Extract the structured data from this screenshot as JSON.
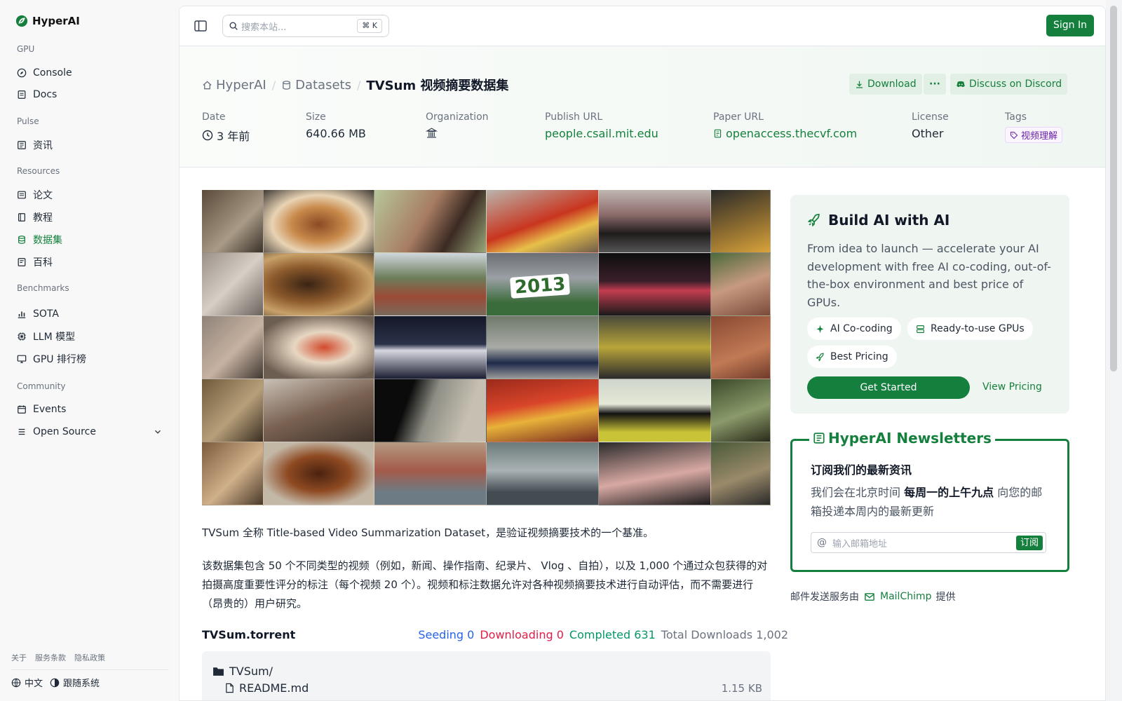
{
  "brand": {
    "name": "HyperAI"
  },
  "sidebar": {
    "sections": [
      {
        "label": "GPU",
        "items": [
          {
            "label": "Console",
            "icon": "compass-icon"
          },
          {
            "label": "Docs",
            "icon": "doc-icon"
          }
        ]
      },
      {
        "label": "Pulse",
        "items": [
          {
            "label": "资讯",
            "icon": "news-icon"
          }
        ]
      },
      {
        "label": "Resources",
        "items": [
          {
            "label": "论文",
            "icon": "paper-icon"
          },
          {
            "label": "教程",
            "icon": "book-icon"
          },
          {
            "label": "数据集",
            "icon": "database-icon",
            "active": true
          },
          {
            "label": "百科",
            "icon": "wiki-icon"
          }
        ]
      },
      {
        "label": "Benchmarks",
        "items": [
          {
            "label": "SOTA",
            "icon": "chart-icon"
          },
          {
            "label": "LLM 模型",
            "icon": "chip-icon"
          },
          {
            "label": "GPU 排行榜",
            "icon": "monitor-icon"
          }
        ]
      },
      {
        "label": "Community",
        "items": [
          {
            "label": "Events",
            "icon": "calendar-icon"
          },
          {
            "label": "Open Source",
            "icon": "list-icon"
          }
        ]
      }
    ],
    "footer": {
      "about": "关于",
      "terms": "服务条款",
      "privacy": "隐私政策",
      "language": "中文",
      "theme": "跟随系统"
    }
  },
  "topbar": {
    "search_placeholder": "搜索本站...",
    "shortcut": "K",
    "sign_in": "Sign In"
  },
  "breadcrumb": {
    "home": "HyperAI",
    "section": "Datasets",
    "current": "TVSum 视频摘要数据集"
  },
  "actions": {
    "download": "Download",
    "more": "···",
    "discord": "Discuss on Discord"
  },
  "meta": {
    "date_label": "Date",
    "date_value": "3 年前",
    "size_label": "Size",
    "size_value": "640.66 MB",
    "org_label": "Organization",
    "publish_label": "Publish URL",
    "publish_value": "people.csail.mit.edu",
    "paper_label": "Paper URL",
    "paper_value": "openaccess.thecvf.com",
    "license_label": "License",
    "license_value": "Other",
    "tags_label": "Tags",
    "tag_value": "视频理解"
  },
  "mosaic": {
    "overlay_year": "2013"
  },
  "description": {
    "p1": "TVSum 全称 Title-based Video Summarization Dataset，是验证视频摘要技术的一个基准。",
    "p2": "该数据集包含 50 个不同类型的视频（例如，新闻、操作指南、纪录片、 Vlog 、自拍），以及 1,000 个通过众包获得的对拍摄高度重要性评分的标注（每个视频 20 个）。视频和标注数据允许对各种视频摘要技术进行自动评估，而不需要进行（昂贵的）用户研究。"
  },
  "torrent": {
    "title": "TVSum.torrent",
    "seeding": "Seeding 0",
    "downloading": "Downloading 0",
    "completed": "Completed 631",
    "total": "Total Downloads 1,002",
    "folder": "TVSum/",
    "file": "README.md",
    "file_size": "1.15 KB"
  },
  "build": {
    "title": "Build AI with AI",
    "desc": "From idea to launch — accelerate your AI development with free AI co-coding, out-of-the-box environment and best price of GPUs.",
    "chip1": "AI Co-coding",
    "chip2": "Ready-to-use GPUs",
    "chip3": "Best Pricing",
    "get_started": "Get Started",
    "view_pricing": "View Pricing"
  },
  "newsletter": {
    "title": "HyperAI Newsletters",
    "subtitle": "订阅我们的最新资讯",
    "text_before": "我们会在北京时间 ",
    "text_bold": "每周一的上午九点",
    "text_after": " 向您的邮箱投递本周内的最新更新",
    "email_placeholder": "输入邮箱地址",
    "subscribe": "订阅",
    "powered_prefix": "邮件发送服务由",
    "powered_name": "MailChimp",
    "powered_suffix": "提供"
  },
  "colors": {
    "accent": "#15803d",
    "seeding": "#2563eb",
    "downloading": "#e11d48",
    "completed": "#059669"
  }
}
